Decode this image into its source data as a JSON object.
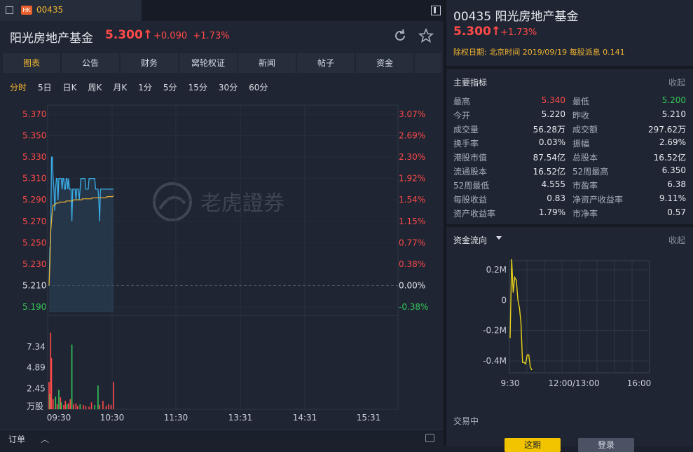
{
  "tab": {
    "market_badge": "HK",
    "code": "00435"
  },
  "header": {
    "name": "阳光房地产基金",
    "price": "5.300",
    "change": "+0.090",
    "change_pct": "+1.73%"
  },
  "main_nav": [
    "图表",
    "公告",
    "财务",
    "窝轮权证",
    "新闻",
    "帖子",
    "资金"
  ],
  "periods": [
    "分时",
    "5日",
    "日K",
    "周K",
    "月K",
    "1分",
    "5分",
    "15分",
    "30分",
    "60分"
  ],
  "chart": {
    "watermark": "老虎證券",
    "price_ticks": [
      {
        "price": "5.370",
        "pct": "3.07%"
      },
      {
        "price": "5.350",
        "pct": "2.69%"
      },
      {
        "price": "5.330",
        "pct": "2.30%"
      },
      {
        "price": "5.310",
        "pct": "1.92%"
      },
      {
        "price": "5.290",
        "pct": "1.54%"
      },
      {
        "price": "5.270",
        "pct": "1.15%"
      },
      {
        "price": "5.250",
        "pct": "0.77%"
      },
      {
        "price": "5.230",
        "pct": "0.38%"
      },
      {
        "price": "5.210",
        "pct": "0.00%"
      },
      {
        "price": "5.190",
        "pct": "-0.38%"
      }
    ],
    "volume_ticks": [
      "7.34",
      "4.89",
      "2.45"
    ],
    "volume_unit": "万股",
    "time_ticks": [
      "09:30",
      "10:30",
      "11:30",
      "13:31",
      "14:31",
      "15:31"
    ],
    "prev_close": 5.21,
    "price_series": [
      5.21,
      5.245,
      5.25,
      5.33,
      5.33,
      5.31,
      5.3,
      5.28,
      5.3,
      5.31,
      5.31,
      5.29,
      5.31,
      5.31,
      5.31,
      5.31,
      5.3,
      5.31,
      5.31,
      5.3,
      5.3,
      5.31,
      5.31,
      5.3,
      5.31,
      5.3,
      5.3,
      5.3,
      5.27,
      5.3,
      5.3,
      5.3,
      5.3,
      5.29,
      5.3,
      5.3,
      5.3,
      5.29,
      5.3,
      5.31,
      5.31,
      5.31,
      5.31,
      5.31,
      5.31,
      5.3,
      5.3,
      5.3,
      5.3,
      5.31,
      5.31,
      5.31,
      5.31,
      5.31,
      5.31,
      5.31,
      5.31,
      5.3,
      5.3,
      5.3,
      5.3,
      5.29,
      5.27,
      5.3,
      5.3,
      5.3,
      5.3,
      5.3,
      5.3,
      5.3,
      5.3,
      5.3,
      5.3,
      5.3,
      5.3,
      5.3,
      5.3,
      5.3,
      5.3,
      5.3
    ],
    "avg_series": [
      5.21,
      5.23,
      5.26,
      5.27,
      5.28,
      5.285,
      5.285,
      5.286,
      5.286,
      5.287,
      5.287,
      5.287,
      5.287,
      5.288,
      5.288,
      5.288,
      5.288,
      5.288,
      5.288,
      5.288,
      5.288,
      5.289,
      5.289,
      5.289,
      5.289,
      5.289,
      5.289,
      5.289,
      5.289,
      5.289,
      5.29,
      5.29,
      5.29,
      5.29,
      5.29,
      5.29,
      5.29,
      5.29,
      5.29,
      5.29,
      5.29,
      5.291,
      5.291,
      5.291,
      5.291,
      5.291,
      5.291,
      5.291,
      5.291,
      5.291,
      5.291,
      5.291,
      5.291,
      5.292,
      5.292,
      5.292,
      5.292,
      5.292,
      5.292,
      5.292,
      5.292,
      5.292,
      5.292,
      5.292,
      5.292,
      5.292,
      5.292,
      5.292,
      5.292,
      5.292,
      5.292,
      5.293,
      5.293,
      5.293,
      5.293,
      5.293,
      5.293,
      5.293,
      5.293,
      5.294
    ],
    "volumes": [
      {
        "i": 0,
        "v": 3.2,
        "up": true
      },
      {
        "i": 1,
        "v": 1.8,
        "up": false
      },
      {
        "i": 2,
        "v": 9.0,
        "up": true
      },
      {
        "i": 3,
        "v": 6.0,
        "up": true
      },
      {
        "i": 5,
        "v": 1.2,
        "up": true
      },
      {
        "i": 8,
        "v": 1.5,
        "up": false
      },
      {
        "i": 10,
        "v": 0.6,
        "up": true
      },
      {
        "i": 12,
        "v": 2.3,
        "up": false
      },
      {
        "i": 14,
        "v": 1.4,
        "up": true
      },
      {
        "i": 15,
        "v": 0.8,
        "up": false
      },
      {
        "i": 18,
        "v": 0.5,
        "up": true
      },
      {
        "i": 20,
        "v": 1.0,
        "up": true
      },
      {
        "i": 22,
        "v": 0.6,
        "up": false
      },
      {
        "i": 24,
        "v": 0.7,
        "up": true
      },
      {
        "i": 26,
        "v": 1.2,
        "up": true
      },
      {
        "i": 28,
        "v": 7.6,
        "up": false
      },
      {
        "i": 30,
        "v": 0.6,
        "up": true
      },
      {
        "i": 33,
        "v": 0.7,
        "up": true
      },
      {
        "i": 35,
        "v": 0.4,
        "up": true
      },
      {
        "i": 38,
        "v": 0.6,
        "up": false
      },
      {
        "i": 42,
        "v": 0.5,
        "up": true
      },
      {
        "i": 45,
        "v": 0.4,
        "up": true
      },
      {
        "i": 49,
        "v": 0.3,
        "up": true
      },
      {
        "i": 52,
        "v": 0.8,
        "up": true
      },
      {
        "i": 56,
        "v": 0.5,
        "up": false
      },
      {
        "i": 60,
        "v": 2.8,
        "up": false
      },
      {
        "i": 62,
        "v": 0.5,
        "up": true
      },
      {
        "i": 66,
        "v": 1.0,
        "up": true
      },
      {
        "i": 70,
        "v": 0.4,
        "up": true
      },
      {
        "i": 73,
        "v": 0.6,
        "up": true
      },
      {
        "i": 76,
        "v": 0.5,
        "up": true
      },
      {
        "i": 79,
        "v": 3.2,
        "up": true
      }
    ]
  },
  "order_bar": {
    "label": "订单"
  },
  "side": {
    "title": "00435 阳光房地产基金",
    "price": "5.300",
    "pct": "+1.73%",
    "ex_dividend": "除权日期: 北京时间 2019/09/19 每股派息 0.141",
    "indicators_title": "主要指标",
    "collapse": "收起",
    "indicators": [
      {
        "k1": "最高",
        "v1": "5.340",
        "c1": "#ff4a4a",
        "k2": "最低",
        "v2": "5.200",
        "c2": "#34c759"
      },
      {
        "k1": "今开",
        "v1": "5.220",
        "k2": "昨收",
        "v2": "5.210"
      },
      {
        "k1": "成交量",
        "v1": "56.28万",
        "k2": "成交额",
        "v2": "297.62万"
      },
      {
        "k1": "换手率",
        "v1": "0.03%",
        "k2": "振幅",
        "v2": "2.69%"
      },
      {
        "k1": "港股市值",
        "v1": "87.54亿",
        "k2": "总股本",
        "v2": "16.52亿"
      },
      {
        "k1": "流通股本",
        "v1": "16.52亿",
        "k2": "52周最高",
        "v2": "6.350"
      },
      {
        "k1": "52周最低",
        "v1": "4.555",
        "k2": "市盈率",
        "v2": "6.38"
      },
      {
        "k1": "每股收益",
        "v1": "0.83",
        "k2": "净资产收益率",
        "v2": "9.11%"
      },
      {
        "k1": "资产收益率",
        "v1": "1.79%",
        "k2": "市净率",
        "v2": "0.57"
      }
    ],
    "flow_title": "资金流向",
    "flow_collapse": "收起",
    "flow_chart": {
      "y_ticks": [
        "0.2M",
        "0",
        "-0.2M",
        "-0.4M"
      ],
      "x_ticks": [
        "9:30",
        "12:00/13:00",
        "16:00"
      ],
      "series": [
        -0.25,
        0.27,
        0.05,
        0.15,
        0.13,
        0.0,
        -0.05,
        -0.15,
        -0.41,
        -0.41,
        -0.42,
        -0.36,
        -0.36,
        -0.44,
        -0.46
      ]
    },
    "status": "交易中",
    "buy_label": "这期",
    "login_label": "登录"
  },
  "colors": {
    "up": "#ff4a4a",
    "down": "#34c759",
    "accent": "#f2b632",
    "price_line": "#3aaee8",
    "avg_line": "#f2b632"
  }
}
